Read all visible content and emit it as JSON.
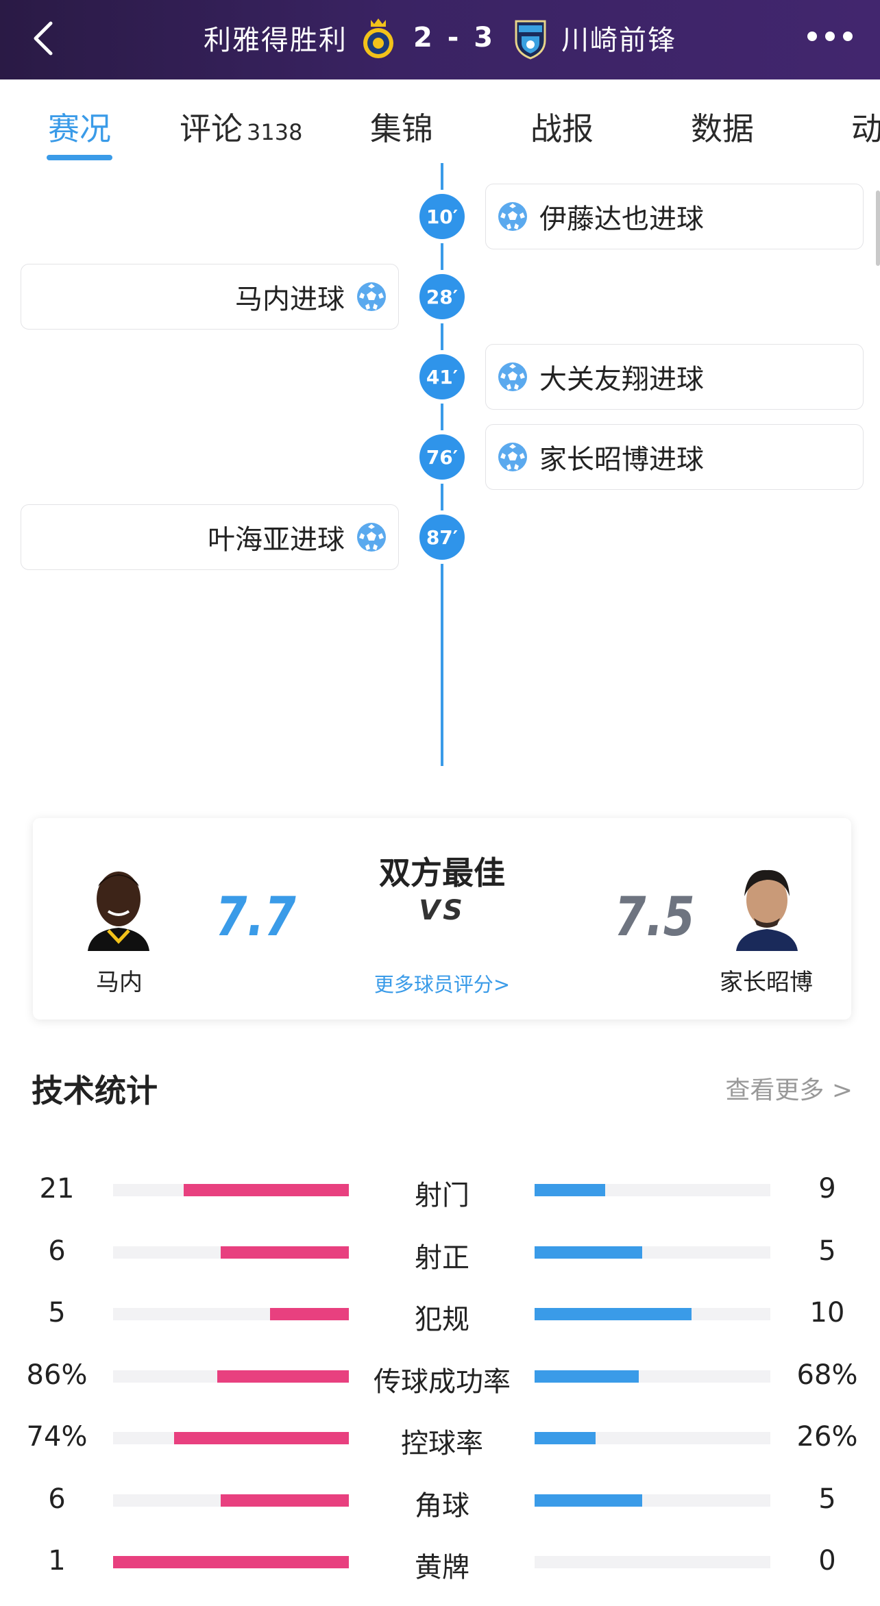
{
  "header": {
    "home_team": "利雅得胜利",
    "away_team": "川崎前锋",
    "score": "2 - 3",
    "colors": {
      "background": "#3a2363",
      "accent": "#3a9be8"
    }
  },
  "tabs": [
    {
      "label": "赛况",
      "active": true
    },
    {
      "label": "评论",
      "count": "3138"
    },
    {
      "label": "集锦"
    },
    {
      "label": "战报"
    },
    {
      "label": "数据"
    },
    {
      "label": "动"
    }
  ],
  "timeline": [
    {
      "minute": "10′",
      "side": "away",
      "text": "伊藤达也进球",
      "icon": "soccer-ball-icon"
    },
    {
      "minute": "28′",
      "side": "home",
      "text": "马内进球",
      "icon": "soccer-ball-icon"
    },
    {
      "minute": "41′",
      "side": "away",
      "text": "大关友翔进球",
      "icon": "soccer-ball-icon"
    },
    {
      "minute": "76′",
      "side": "away",
      "text": "家长昭博进球",
      "icon": "soccer-ball-icon"
    },
    {
      "minute": "87′",
      "side": "home",
      "text": "叶海亚进球",
      "icon": "soccer-ball-icon"
    }
  ],
  "best_players": {
    "title": "双方最佳",
    "vs": "VS",
    "more_link": "更多球员评分>",
    "home": {
      "name": "马内",
      "rating": "7.7",
      "color": "#3a9be8"
    },
    "away": {
      "name": "家长昭博",
      "rating": "7.5",
      "color": "#6e7480"
    }
  },
  "stats": {
    "title": "技术统计",
    "more": "查看更多 >",
    "colors": {
      "home": "#e8407f",
      "away": "#3a9be8"
    },
    "rows": [
      {
        "label": "射门",
        "home": "21",
        "away": "9",
        "home_fill": 0.7,
        "away_fill": 0.3
      },
      {
        "label": "射正",
        "home": "6",
        "away": "5",
        "home_fill": 0.545,
        "away_fill": 0.455
      },
      {
        "label": "犯规",
        "home": "5",
        "away": "10",
        "home_fill": 0.333,
        "away_fill": 0.667
      },
      {
        "label": "传球成功率",
        "home": "86%",
        "away": "68%",
        "home_fill": 0.558,
        "away_fill": 0.442
      },
      {
        "label": "控球率",
        "home": "74%",
        "away": "26%",
        "home_fill": 0.74,
        "away_fill": 0.26
      },
      {
        "label": "角球",
        "home": "6",
        "away": "5",
        "home_fill": 0.545,
        "away_fill": 0.455
      },
      {
        "label": "黄牌",
        "home": "1",
        "away": "0",
        "home_fill": 1.0,
        "away_fill": 0.0
      }
    ]
  }
}
